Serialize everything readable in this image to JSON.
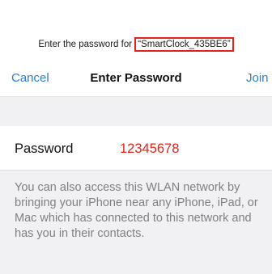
{
  "prompt": {
    "text": "Enter the password for ",
    "network_name": "“SmartClock_435BE6”"
  },
  "navbar": {
    "cancel_label": "Cancel",
    "title": "Enter Password",
    "join_label": "Join"
  },
  "password_row": {
    "label": "Password",
    "value": "12345678"
  },
  "footer": {
    "text": "You can also access this WLAN network by bringing your iPhone near any iPhone, iPad, or Mac which has connected to this network and has you in their contacts."
  },
  "colors": {
    "accent": "#2e7ecb",
    "highlight": "#e0231c",
    "background_gray": "#f1f1f3"
  }
}
